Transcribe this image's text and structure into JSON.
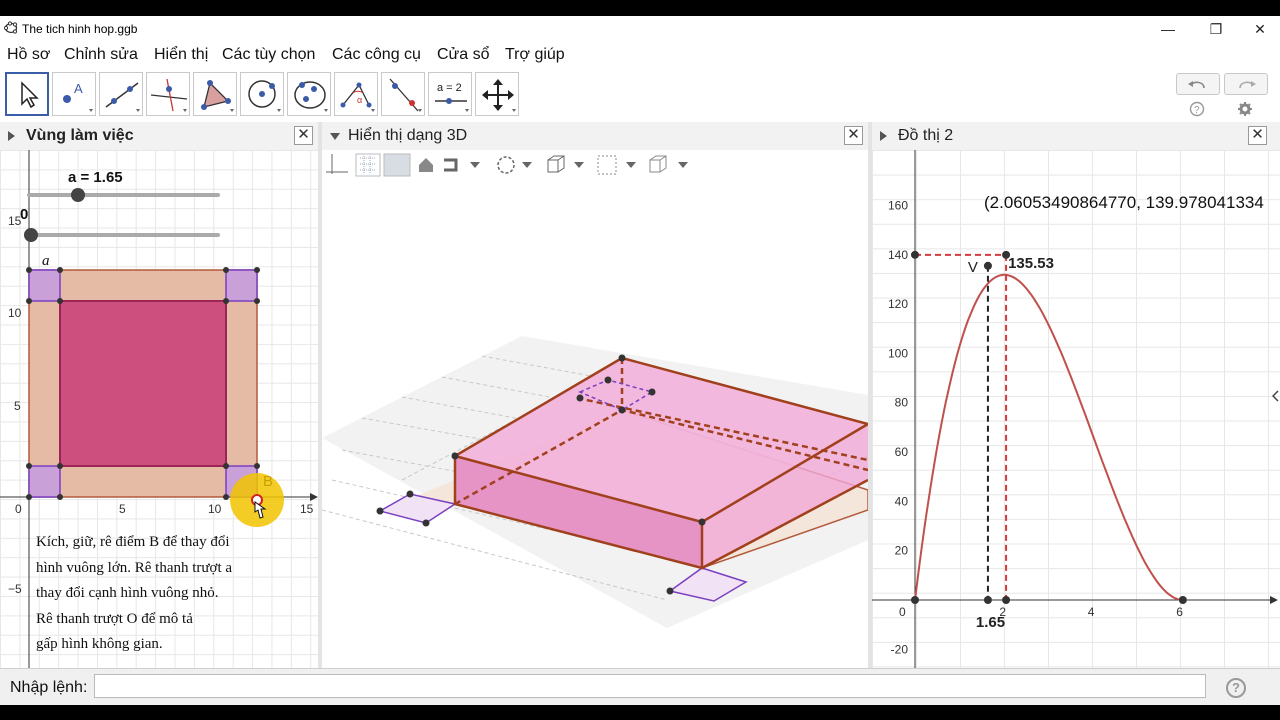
{
  "window": {
    "title": "The tich hinh hop.ggb",
    "minimize": "—",
    "maximize": "❐",
    "close": "✕"
  },
  "menu": [
    "Hồ sơ",
    "Chỉnh sửa",
    "Hiển thị",
    "Các tùy chọn",
    "Các công cụ",
    "Cửa sổ",
    "Trợ giúp"
  ],
  "toolbar": {
    "tools": [
      "move-tool",
      "point-tool",
      "line-tool",
      "perpendicular-tool",
      "polygon-tool",
      "circle-tool",
      "conic-tool",
      "angle-tool",
      "reflect-tool",
      "slider-tool",
      "move-graphics-tool"
    ],
    "slider_tool_text": "a = 2"
  },
  "panels": {
    "algebra": {
      "title": "Vùng làm việc"
    },
    "view3d": {
      "title": "Hiển thị dạng 3D"
    },
    "graph2": {
      "title": "Đồ thị 2"
    }
  },
  "workspace": {
    "slider_a_label": "a = 1.65",
    "slider_a_value": 1.65,
    "slider_o_label": "0",
    "point_a": "a",
    "point_b": "B",
    "x_ticks": [
      "0",
      "5",
      "10",
      "15"
    ],
    "y_ticks": [
      "15",
      "10",
      "5",
      "−5"
    ],
    "instructions": [
      "Kích, giữ, rê điểm B để thay đổi",
      "hình vuông lớn. Rê thanh trượt a",
      "thay đổi cạnh hình vuông nhỏ.",
      "Rê thanh trượt O để mô tả",
      "gấp hình không gian."
    ]
  },
  "chart_data": {
    "type": "line",
    "title": "",
    "xlabel": "",
    "ylabel": "",
    "xlim": [
      0,
      8.5
    ],
    "ylim": [
      -30,
      172
    ],
    "x_ticks": [
      "0",
      "2",
      "4",
      "6"
    ],
    "y_ticks": [
      "-20",
      "20",
      "40",
      "60",
      "80",
      "100",
      "120",
      "140",
      "160"
    ],
    "series": [
      {
        "function": "V(x) = x·(12.12 − 2x)²",
        "color": "#c0504d"
      }
    ],
    "max_point": {
      "x": 2.0605349086477,
      "y": 139.978041334
    },
    "max_text": "(2.06053490864770, 139.978041334",
    "current_point": {
      "x": 1.65,
      "y": 135.53,
      "label": "V",
      "value_label": "135.53"
    },
    "x_marker_label": "1.65",
    "zero_point_x": 6.06
  },
  "input_bar": {
    "label": "Nhập lệnh:",
    "value": "",
    "help": "?"
  }
}
